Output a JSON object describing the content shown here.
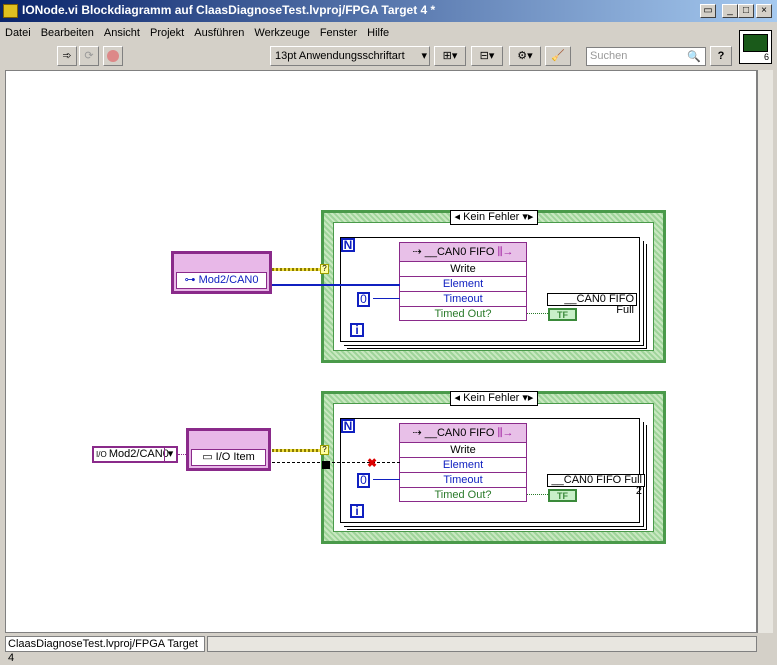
{
  "window": {
    "title": "IONode.vi Blockdiagramm auf ClaasDiagnoseTest.lvproj/FPGA Target 4 *"
  },
  "menu": [
    "Datei",
    "Bearbeiten",
    "Ansicht",
    "Projekt",
    "Ausführen",
    "Werkzeuge",
    "Fenster",
    "Hilfe"
  ],
  "toolbar": {
    "font": "13pt Anwendungsschriftart",
    "search_placeholder": "Suchen",
    "help": "?",
    "icon_number": "6"
  },
  "diagram": {
    "case1": {
      "selector": "Kein Fehler",
      "node_label": "Mod2/CAN0",
      "fifo": "__CAN0 FIFO",
      "method": "Write",
      "element": "Element",
      "timeout": "Timeout",
      "timed_out": "Timed Out?",
      "const": "0",
      "indicator": "__CAN0 FIFO Full",
      "tf": "TF",
      "n": "N",
      "i": "i"
    },
    "case2": {
      "selector": "Kein Fehler",
      "io_const": "Mod2/CAN0",
      "node_label": "I/O Item",
      "fifo": "__CAN0 FIFO",
      "method": "Write",
      "element": "Element",
      "timeout": "Timeout",
      "timed_out": "Timed Out?",
      "const": "0",
      "indicator": "__CAN0 FIFO Full 2",
      "tf": "TF",
      "n": "N",
      "i": "i"
    }
  },
  "status": "ClaasDiagnoseTest.lvproj/FPGA Target 4"
}
